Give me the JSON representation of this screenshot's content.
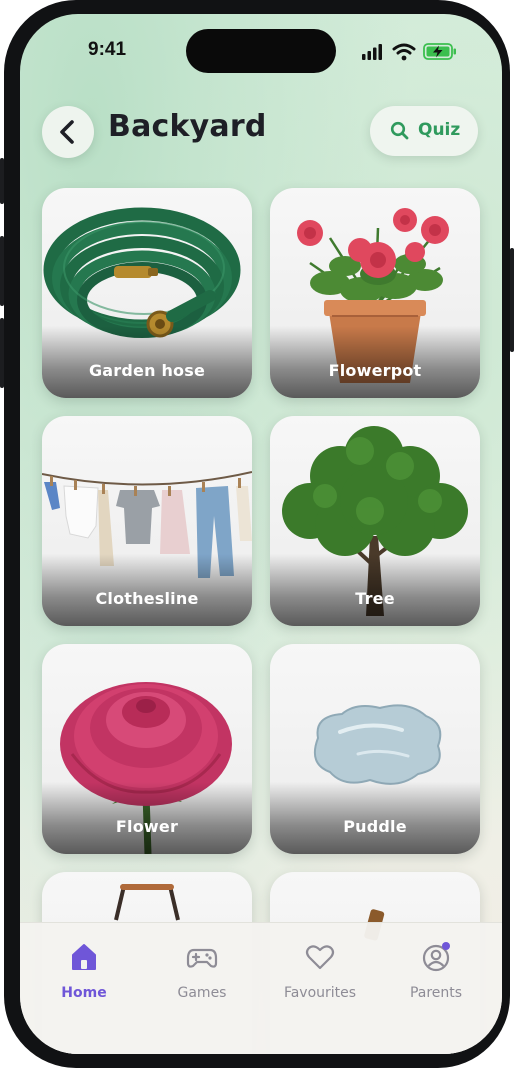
{
  "status_bar": {
    "time": "9:41"
  },
  "header": {
    "title": "Backyard",
    "quiz_label": "Quiz"
  },
  "items": [
    {
      "label": "Garden hose"
    },
    {
      "label": "Flowerpot"
    },
    {
      "label": "Clothesline"
    },
    {
      "label": "Tree"
    },
    {
      "label": "Flower"
    },
    {
      "label": "Puddle"
    }
  ],
  "tab_bar": {
    "tabs": [
      {
        "label": "Home",
        "icon": "home-icon",
        "active": true
      },
      {
        "label": "Games",
        "icon": "gamepad-icon"
      },
      {
        "label": "Favourites",
        "icon": "heart-icon"
      },
      {
        "label": "Parents",
        "icon": "user-circle-icon",
        "has_notification": true
      }
    ]
  },
  "colors": {
    "accent": "#6f56d8",
    "quiz_green": "#2f9a5d",
    "title_text": "#1e1f26",
    "inactive_tab": "#8e8c96"
  }
}
